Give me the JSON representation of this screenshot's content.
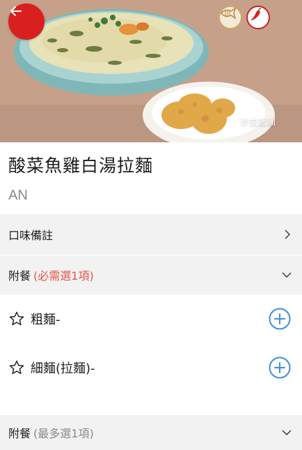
{
  "hero": {
    "back_icon": "arrow-left-icon",
    "badges": [
      "fish-icon",
      "chili-pepper-icon"
    ],
    "watermark": "沙拉飯團",
    "colors": {
      "back_button": "#d9201e",
      "spicy_badge": "#c92420"
    }
  },
  "dish": {
    "title": "酸菜魚雞白湯拉麵",
    "subtitle": "AN"
  },
  "note_row": {
    "label": "口味備註",
    "icon": "chevron-right-icon"
  },
  "side_group_1": {
    "label": "附餐",
    "hint": "(必需選1項)",
    "icon": "chevron-down-icon",
    "hint_color": "#e5534b",
    "options": [
      {
        "label": "粗麵-",
        "fav_icon": "star-outline-icon",
        "action_icon": "plus-circle-icon"
      },
      {
        "label": "細麵(拉麵)-",
        "fav_icon": "star-outline-icon",
        "action_icon": "plus-circle-icon"
      }
    ]
  },
  "side_group_2": {
    "label": "附餐",
    "hint": "(最多選1項)",
    "icon": "chevron-down-icon"
  },
  "accent_color": "#3b8fd9"
}
